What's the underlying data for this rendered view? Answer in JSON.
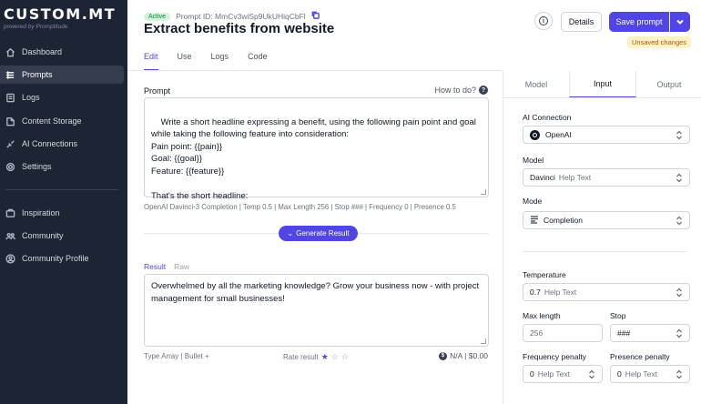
{
  "brand": {
    "name": "CUSTOM.MT",
    "sub": "powered by Promptitude"
  },
  "sidebar": {
    "items": [
      {
        "label": "Dashboard",
        "icon": "home-icon"
      },
      {
        "label": "Prompts",
        "icon": "prompts-icon",
        "active": true
      },
      {
        "label": "Logs",
        "icon": "logs-icon"
      },
      {
        "label": "Content Storage",
        "icon": "storage-icon"
      },
      {
        "label": "AI Connections",
        "icon": "connections-icon"
      },
      {
        "label": "Settings",
        "icon": "gear-icon"
      }
    ],
    "secondary": [
      {
        "label": "Inspiration",
        "icon": "inspiration-icon"
      },
      {
        "label": "Community",
        "icon": "community-icon"
      },
      {
        "label": "Community Profile",
        "icon": "profile-icon"
      }
    ]
  },
  "header": {
    "status": "Active",
    "prompt_id": "Prompt ID: MmCv3wiSp9UkUHiqCbFl",
    "title": "Extract benefits from website",
    "details_label": "Details",
    "save_label": "Save prompt",
    "unsaved_label": "Unsaved changes",
    "info_glyph": "i"
  },
  "tabs": [
    "Edit",
    "Use",
    "Logs",
    "Code"
  ],
  "prompt": {
    "label": "Prompt",
    "howto": "How to do?",
    "text": "Write a short headline expressing a benefit, using the following pain point and goal while taking the following feature into consideration:\nPain point: {{pain}}\nGoal: {{goal}}\nFeature: {{feature}}\n\nThat's the short headline:",
    "meta": "OpenAI Davinci-3 Completion | Temp 0.5 | Max Length 256 | Stop ### | Frequency 0 | Presence 0.5",
    "generate_label": "Generate Result"
  },
  "result": {
    "tabs": [
      "Result",
      "Raw"
    ],
    "text": "Overwhelmed by all the marketing knowledge? Grow your business now - with project management for small businesses!",
    "type_info": "Type Array | Bullet +",
    "rate_label": "Rate result",
    "rating": 1,
    "cost": "N/A | $0.00"
  },
  "right_panel": {
    "tabs": [
      "Model",
      "Input",
      "Output"
    ],
    "active_tab": "Input",
    "ai_connection": {
      "label": "AI Connection",
      "value": "OpenAI"
    },
    "model": {
      "label": "Model",
      "value": "Davinci",
      "hint": "Help Text"
    },
    "mode": {
      "label": "Mode",
      "value": "Completion"
    },
    "temperature": {
      "label": "Temperature",
      "value": "0.7",
      "hint": "Help Text"
    },
    "max_length": {
      "label": "Max length",
      "value": "256"
    },
    "stop": {
      "label": "Stop",
      "value": "###"
    },
    "frequency": {
      "label": "Frequency penalty",
      "value": "0",
      "hint": "Help Text"
    },
    "presence": {
      "label": "Presence penalty",
      "value": "0",
      "hint": "Help Text"
    }
  },
  "colors": {
    "accent": "#4f46e5",
    "sidebar_bg": "#1d2433",
    "active_badge": "#d1f5dd",
    "unsaved_bg": "#fef3c7"
  }
}
